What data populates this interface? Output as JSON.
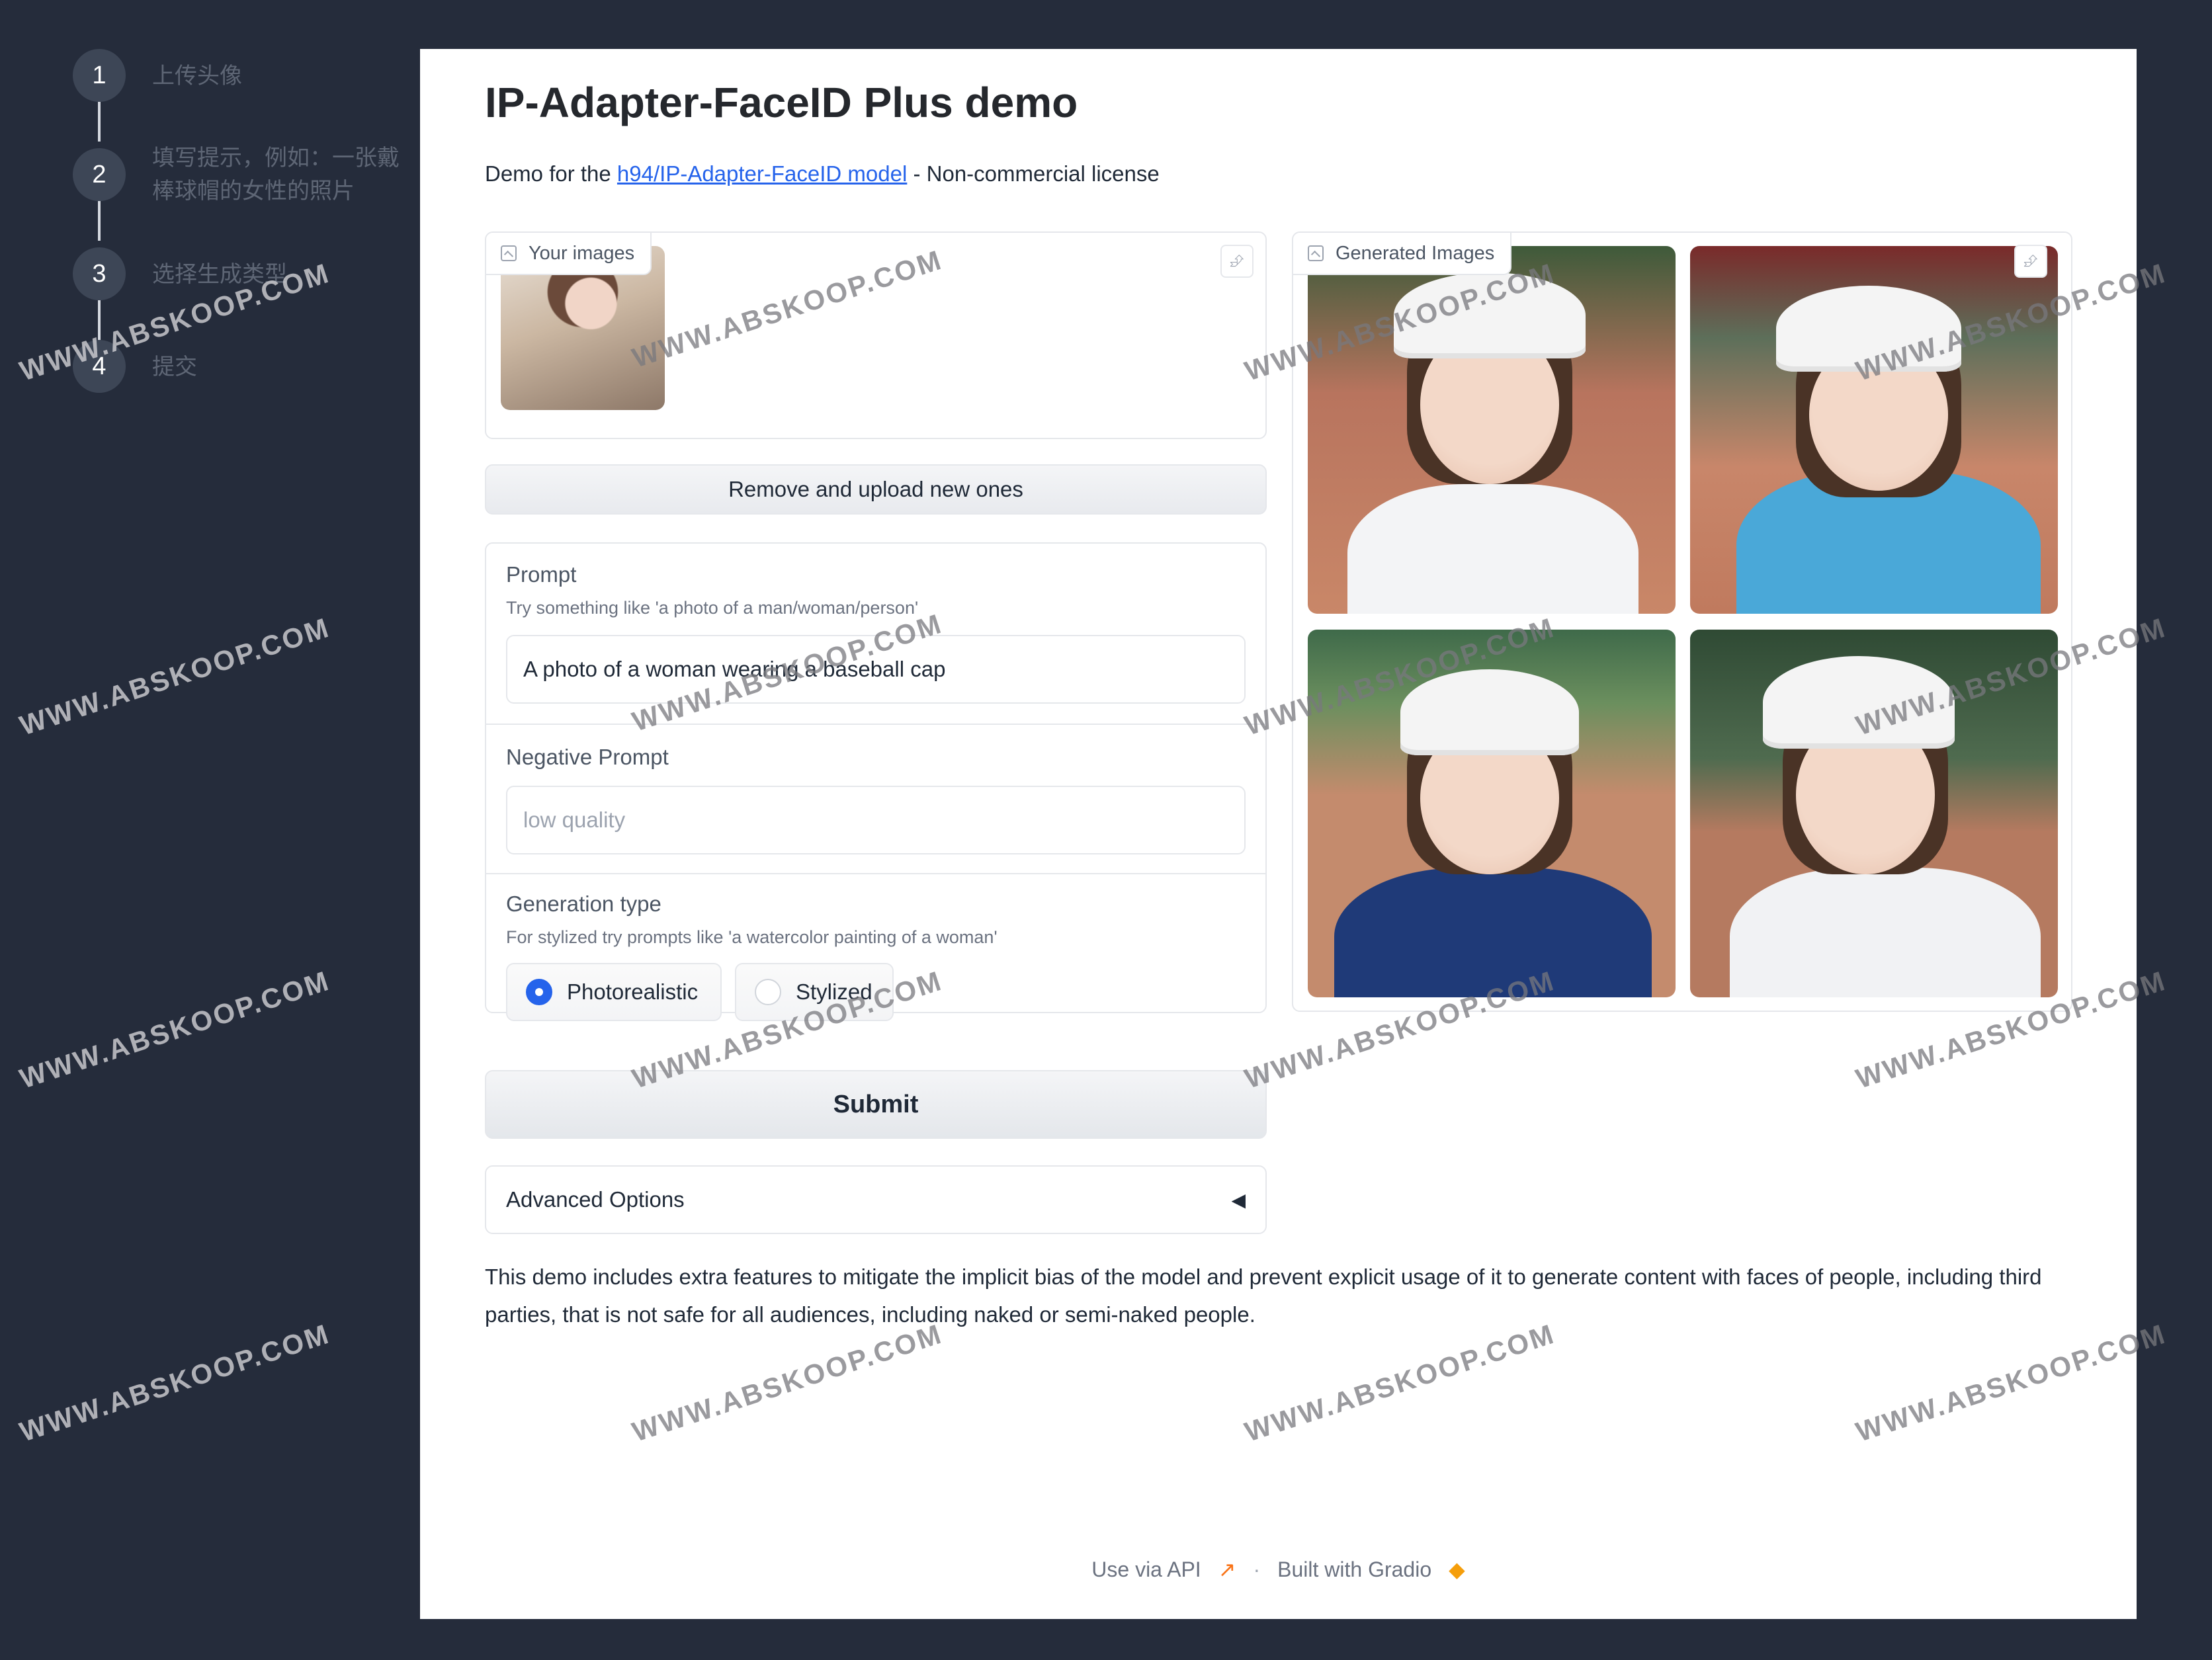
{
  "steps": [
    {
      "num": "1",
      "label": "上传头像"
    },
    {
      "num": "2",
      "label": "填写提示，例如：一张戴棒球帽的女性的照片"
    },
    {
      "num": "3",
      "label": "选择生成类型"
    },
    {
      "num": "4",
      "label": "提交"
    }
  ],
  "header": {
    "title": "IP-Adapter-FaceID Plus demo",
    "subtitle_prefix": "Demo for the ",
    "subtitle_link": "h94/IP-Adapter-FaceID model",
    "subtitle_suffix": " - Non-commercial license"
  },
  "upload": {
    "label": "Your images",
    "share_icon": "share-icon",
    "remove_button": "Remove and upload new ones"
  },
  "prompt": {
    "label": "Prompt",
    "info": "Try something like 'a photo of a man/woman/person'",
    "value": "A photo of a woman wearing a baseball cap"
  },
  "negative_prompt": {
    "label": "Negative Prompt",
    "placeholder": "low quality"
  },
  "generation_type": {
    "label": "Generation type",
    "info": "For stylized try prompts like 'a watercolor painting of a woman'",
    "options": [
      "Photorealistic",
      "Stylized"
    ],
    "selected": "Photorealistic"
  },
  "submit_label": "Submit",
  "advanced_label": "Advanced Options",
  "gallery": {
    "label": "Generated Images"
  },
  "disclaimer": "This demo includes extra features to mitigate the implicit bias of the model and prevent explicit usage of it to generate content with faces of people, including third parties, that is not safe for all audiences, including naked or semi-naked people.",
  "footer": {
    "api": "Use via API",
    "sep": "·",
    "built": "Built with Gradio"
  },
  "watermark": "WWW.ABSKOOP.COM",
  "colors": {
    "background": "#252c3b",
    "panel": "#ffffff",
    "link": "#2563eb",
    "radio_selected": "#2563eb"
  }
}
